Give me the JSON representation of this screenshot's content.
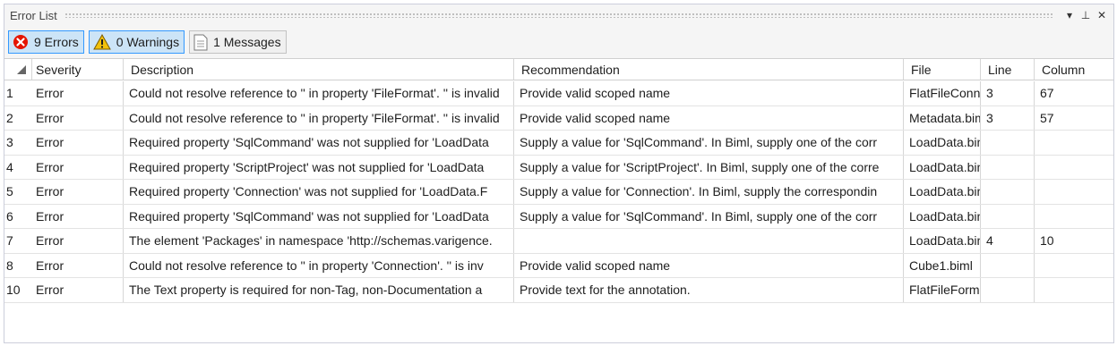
{
  "panel": {
    "title": "Error List",
    "buttons": {
      "dropdown": "▾",
      "pin": "⊥",
      "close": "✕"
    }
  },
  "toolbar": {
    "errors_label": "9 Errors",
    "warnings_label": "0 Warnings",
    "messages_label": "1 Messages"
  },
  "table": {
    "headers": {
      "severity": "Severity",
      "description": "Description",
      "recommendation": "Recommendation",
      "file": "File",
      "line": "Line",
      "column": "Column"
    },
    "rows": [
      {
        "num": "1",
        "severity": "Error",
        "description": "Could not resolve reference to '' in property 'FileFormat'. '' is invalid",
        "recommendation": "Provide valid scoped name",
        "file": "FlatFileConnection",
        "line": "3",
        "column": "67"
      },
      {
        "num": "2",
        "severity": "Error",
        "description": "Could not resolve reference to '' in property 'FileFormat'. '' is invalid",
        "recommendation": "Provide valid scoped name",
        "file": "Metadata.biml",
        "line": "3",
        "column": "57"
      },
      {
        "num": "3",
        "severity": "Error",
        "description": "Required property 'SqlCommand' was not supplied for 'LoadData",
        "recommendation": "Supply a value for 'SqlCommand'. In Biml, supply one of the corr",
        "file": "LoadData.biml",
        "line": "",
        "column": ""
      },
      {
        "num": "4",
        "severity": "Error",
        "description": "Required property 'ScriptProject' was not supplied for 'LoadData",
        "recommendation": "Supply a value for 'ScriptProject'. In Biml, supply one of the corre",
        "file": "LoadData.biml",
        "line": "",
        "column": ""
      },
      {
        "num": "5",
        "severity": "Error",
        "description": "Required property 'Connection' was not supplied for 'LoadData.F",
        "recommendation": "Supply a value for 'Connection'. In Biml, supply the correspondin",
        "file": "LoadData.biml",
        "line": "",
        "column": ""
      },
      {
        "num": "6",
        "severity": "Error",
        "description": "Required property 'SqlCommand' was not supplied for 'LoadData",
        "recommendation": "Supply a value for 'SqlCommand'. In Biml, supply one of the corr",
        "file": "LoadData.biml",
        "line": "",
        "column": ""
      },
      {
        "num": "7",
        "severity": "Error",
        "description": "The element 'Packages' in namespace 'http://schemas.varigence.",
        "recommendation": "",
        "file": "LoadData.biml",
        "line": "4",
        "column": "10"
      },
      {
        "num": "8",
        "severity": "Error",
        "description": "Could not resolve reference to '' in property 'Connection'. '' is inv",
        "recommendation": "Provide valid scoped name",
        "file": "Cube1.biml",
        "line": "",
        "column": ""
      },
      {
        "num": "10",
        "severity": "Error",
        "description": "The Text property is required for non-Tag, non-Documentation a",
        "recommendation": "Provide text for the annotation.",
        "file": "FlatFileFormat",
        "line": "",
        "column": ""
      }
    ]
  },
  "colors": {
    "active_button_bg": "#cce4f7",
    "active_button_border": "#3399ff",
    "error_icon": "#e51400",
    "warning_icon": "#f2c10a"
  },
  "icons": {
    "errors": "error-circle-icon",
    "warnings": "warning-triangle-icon",
    "messages": "message-document-icon"
  }
}
